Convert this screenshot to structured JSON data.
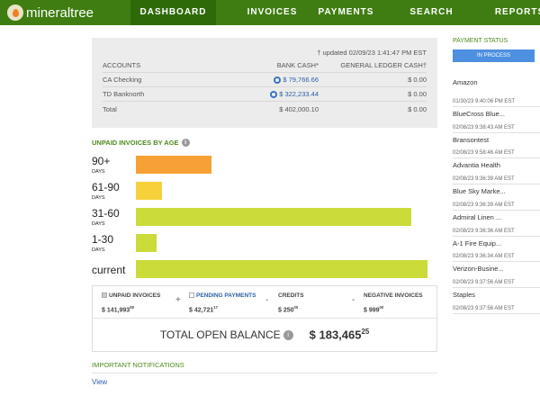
{
  "nav": {
    "logo": "mineraltree",
    "tabs": [
      "DASHBOARD",
      "INVOICES",
      "PAYMENTS",
      "SEARCH",
      "REPORTS"
    ],
    "active": "DASHBOARD",
    "brand_color": "#3f7d12"
  },
  "accounts": {
    "updated": "† updated 02/09/23 1:41:47 PM EST",
    "headers": [
      "ACCOUNTS",
      "BANK CASH*",
      "GENERAL LEDGER CASH†"
    ],
    "rows": [
      {
        "name": "CA Checking",
        "bank": "$ 79,766.66",
        "gl": "$ 0.00"
      },
      {
        "name": "TD Banknorth",
        "bank": "$ 322,233.44",
        "gl": "$ 0.00"
      },
      {
        "name": "Total",
        "bank": "$ 402,000.10",
        "gl": "$ 0.00"
      }
    ]
  },
  "aging": {
    "title": "UNPAID INVOICES BY AGE",
    "buckets": [
      {
        "label": "90+",
        "unit": "DAYS",
        "relative": 0.26,
        "color": "#f7a035"
      },
      {
        "label": "61-90",
        "unit": "DAYS",
        "relative": 0.09,
        "color": "#f7d13c"
      },
      {
        "label": "31-60",
        "unit": "DAYS",
        "relative": 0.945,
        "color": "#cadb3a"
      },
      {
        "label": "1-30",
        "unit": "DAYS",
        "relative": 0.07,
        "color": "#cadb3a"
      },
      {
        "label": "current",
        "unit": "",
        "relative": 1.0,
        "color": "#cadb3a"
      }
    ]
  },
  "summary": {
    "unpaid_label": "UNPAID INVOICES",
    "unpaid": "$ 141,993",
    "unpaid_c": "08",
    "pending_label": "PENDING PAYMENTS",
    "pending": "$ 42,721",
    "pending_c": "17",
    "credits_label": "CREDITS",
    "credits": "$ 250",
    "credits_c": "00",
    "neg_label": "NEGATIVE INVOICES",
    "neg": "$ 999",
    "neg_c": "00",
    "plus": "+",
    "minus": "-",
    "total_label": "TOTAL OPEN BALANCE",
    "total": "$ 183,465",
    "total_c": "25"
  },
  "notifications": {
    "title": "IMPORTANT NOTIFICATIONS",
    "view": "View"
  },
  "payment_status": {
    "title": "PAYMENT STATUS",
    "tab": "IN PROCESS",
    "first": "Amazon",
    "items": [
      {
        "ts": "01/30/23 9:40:06 PM EST",
        "name": "BlueCross Blue..."
      },
      {
        "ts": "02/08/23 9:38:43 AM EST",
        "name": "Bransontest"
      },
      {
        "ts": "02/08/23 9:58:46 AM EST",
        "name": "Advantia Health"
      },
      {
        "ts": "02/08/23 9:36:39 AM EST",
        "name": "Blue Sky Marke..."
      },
      {
        "ts": "02/08/23 9:36:39 AM EST",
        "name": "Admiral Linen ..."
      },
      {
        "ts": "02/08/23 9:36:36 AM EST",
        "name": "A-1 Fire Equip..."
      },
      {
        "ts": "02/08/23 9:36:34 AM EST",
        "name": "Verizon-Busine..."
      },
      {
        "ts": "02/08/23 9:37:56 AM EST",
        "name": "Staples"
      },
      {
        "ts": "02/08/23 9:37:56 AM EST",
        "name": ""
      }
    ]
  }
}
